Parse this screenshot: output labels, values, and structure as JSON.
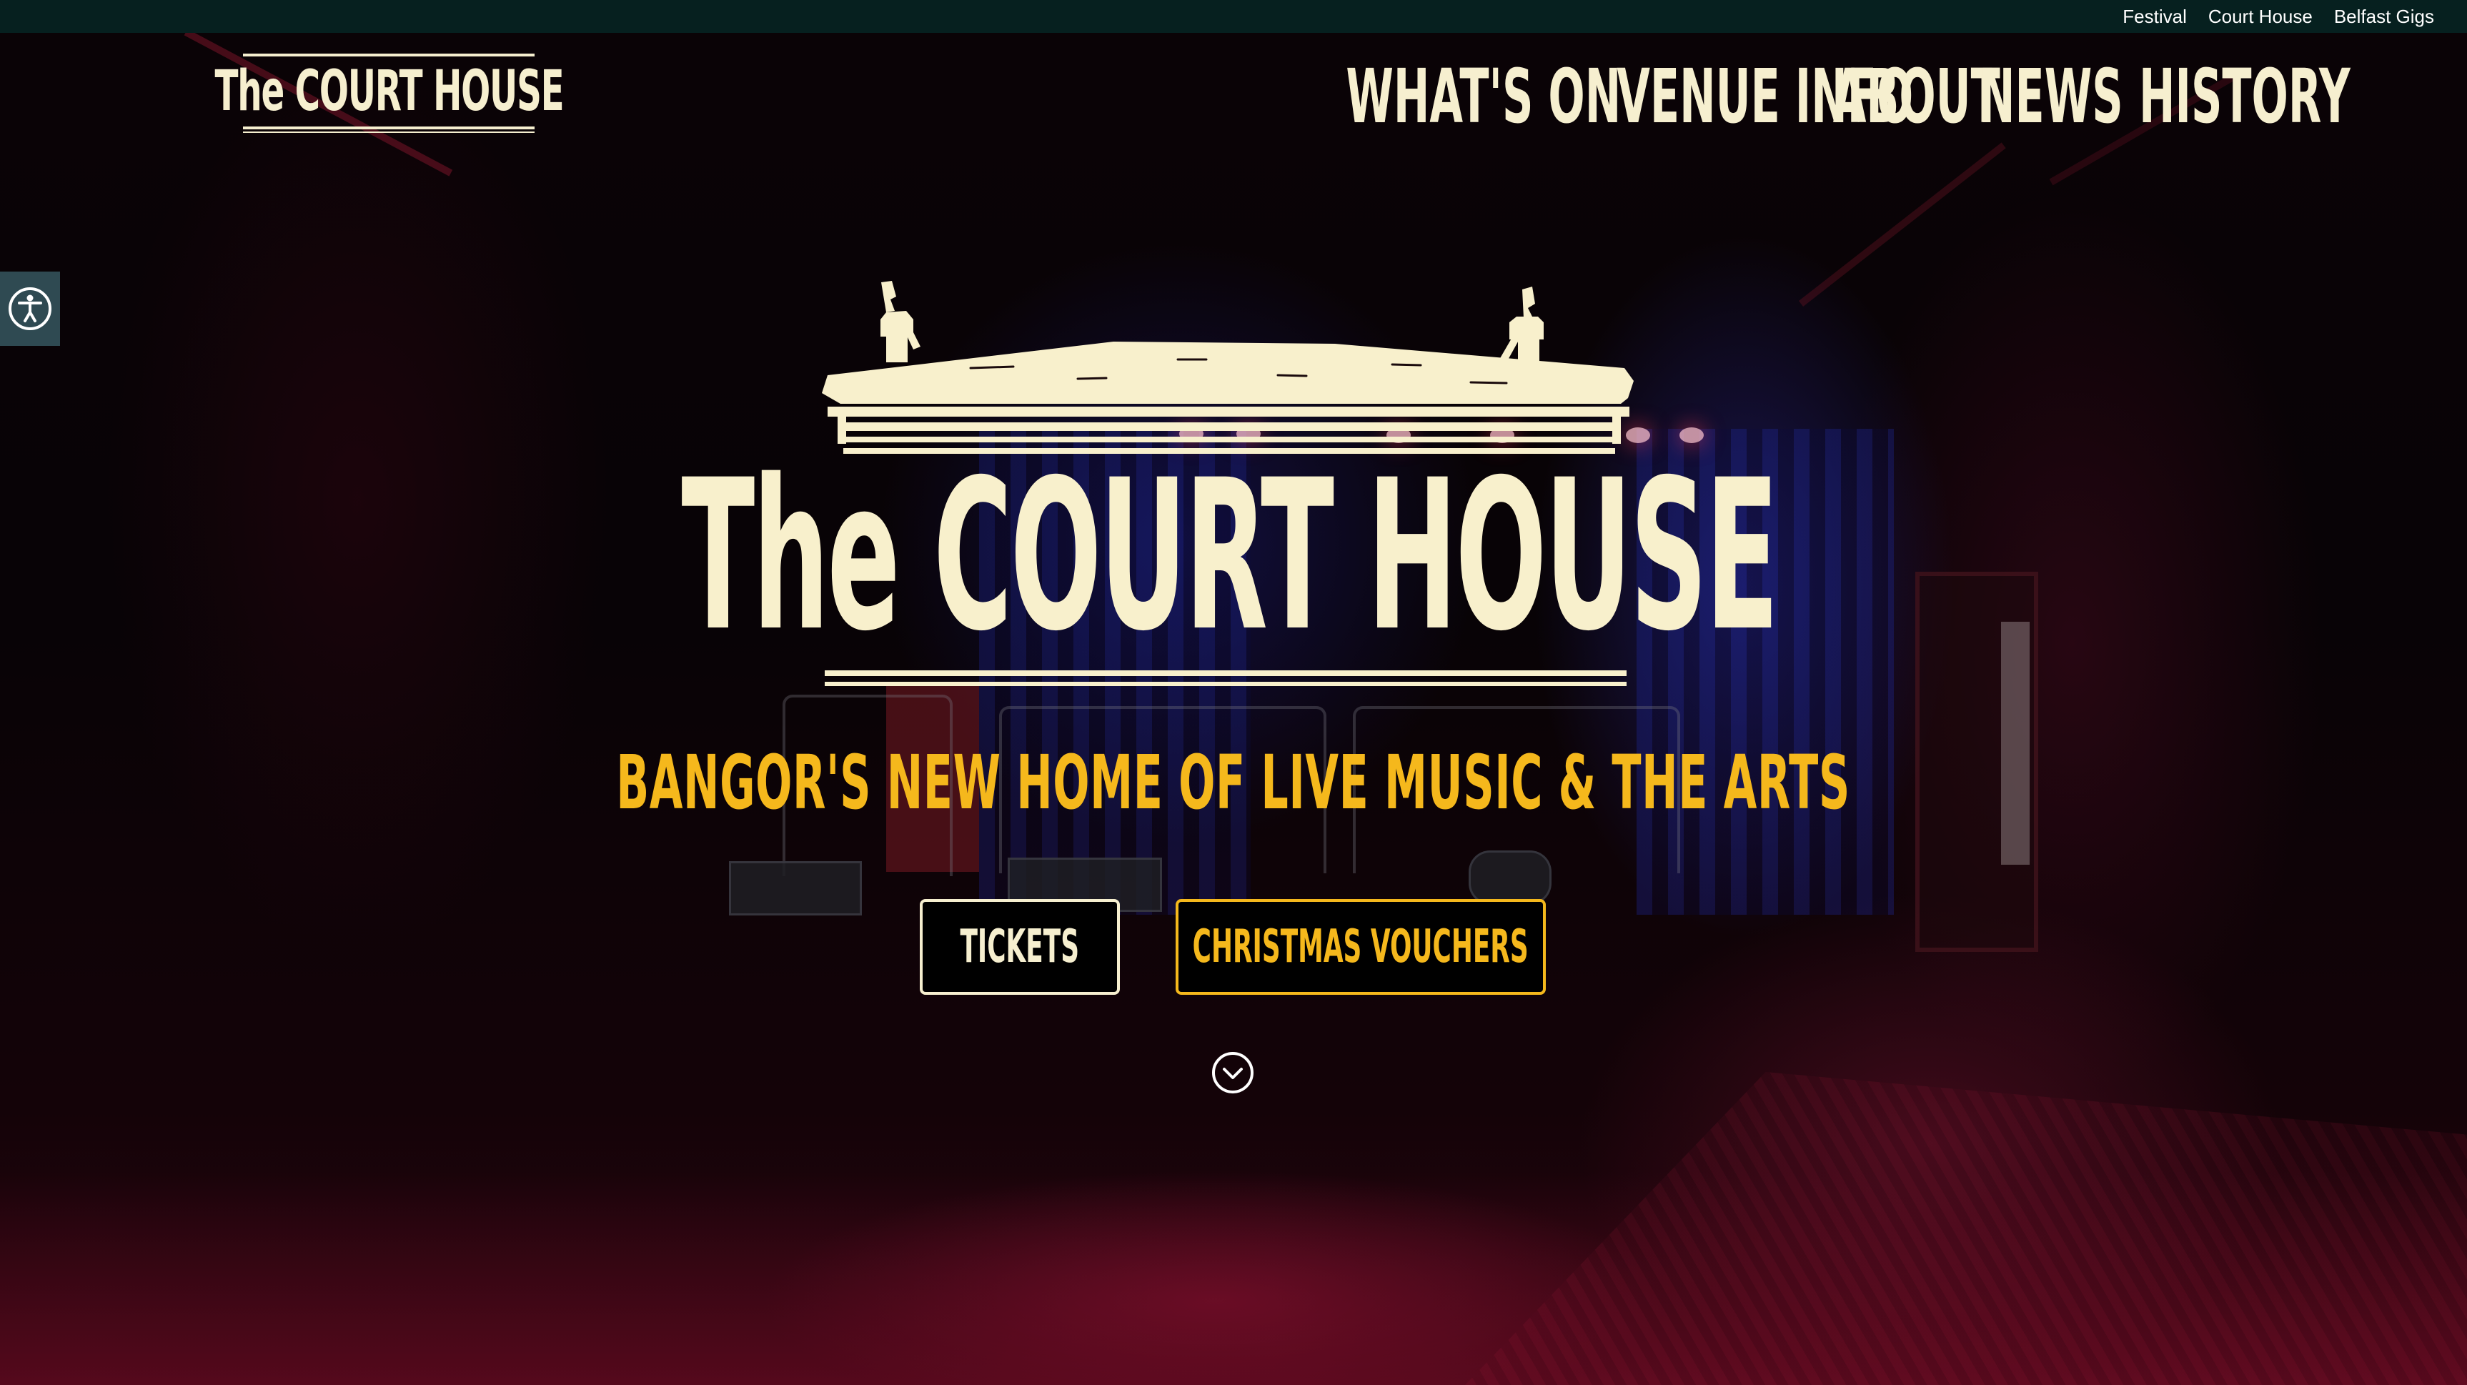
{
  "topbar": {
    "links": [
      {
        "label": "Festival"
      },
      {
        "label": "Court House"
      },
      {
        "label": "Belfast Gigs"
      }
    ]
  },
  "header": {
    "logo_text": "The COURT HOUSE",
    "nav": [
      {
        "label": "WHAT'S ON"
      },
      {
        "label": "VENUE INFO"
      },
      {
        "label": "ABOUT"
      },
      {
        "label": "NEWS"
      },
      {
        "label": "HISTORY"
      }
    ]
  },
  "accessibility": {
    "icon": "accessibility-icon"
  },
  "hero": {
    "title": "The COURT HOUSE",
    "tagline": "BANGOR'S NEW HOME OF LIVE MUSIC & THE ARTS",
    "buttons": {
      "tickets": "TICKETS",
      "vouchers": "CHRISTMAS VOUCHERS"
    },
    "scroll_icon": "chevron-down-circle-icon"
  },
  "colors": {
    "cream": "#f6efcf",
    "gold": "#f5b81c",
    "topbar": "#06201f",
    "a11y_tab": "#2f4a52"
  }
}
